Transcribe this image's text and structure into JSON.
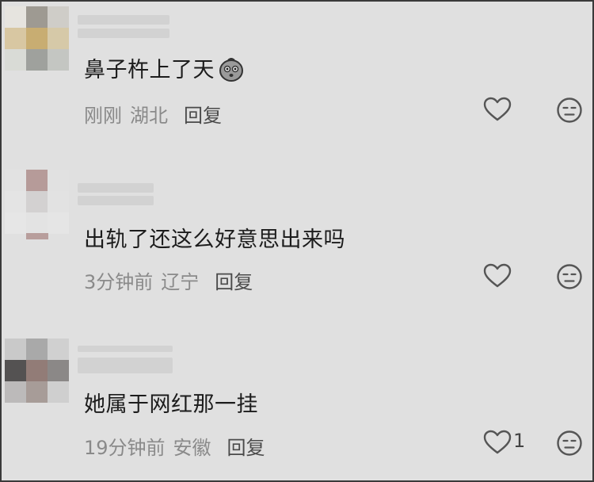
{
  "comments": [
    {
      "text": "鼻子杵上了天",
      "time": "刚刚",
      "location": "湖北",
      "reply_label": "回复",
      "like_count": "",
      "emoji": "sweat-face-emoji"
    },
    {
      "text": "出轨了还这么好意思出来吗",
      "time": "3分钟前",
      "location": "辽宁",
      "reply_label": "回复",
      "like_count": ""
    },
    {
      "text": "她属于网红那一挂",
      "time": "19分钟前",
      "location": "安徽",
      "reply_label": "回复",
      "like_count": "1"
    }
  ],
  "icons": {
    "like": "heart-outline-icon",
    "dislike": "meh-face-icon"
  },
  "colors": {
    "background": "#e0e0e0",
    "text": "#1c1c1c",
    "meta": "#8a8a8a",
    "reply": "#4a4a4a",
    "icon": "#5a5a5a"
  }
}
